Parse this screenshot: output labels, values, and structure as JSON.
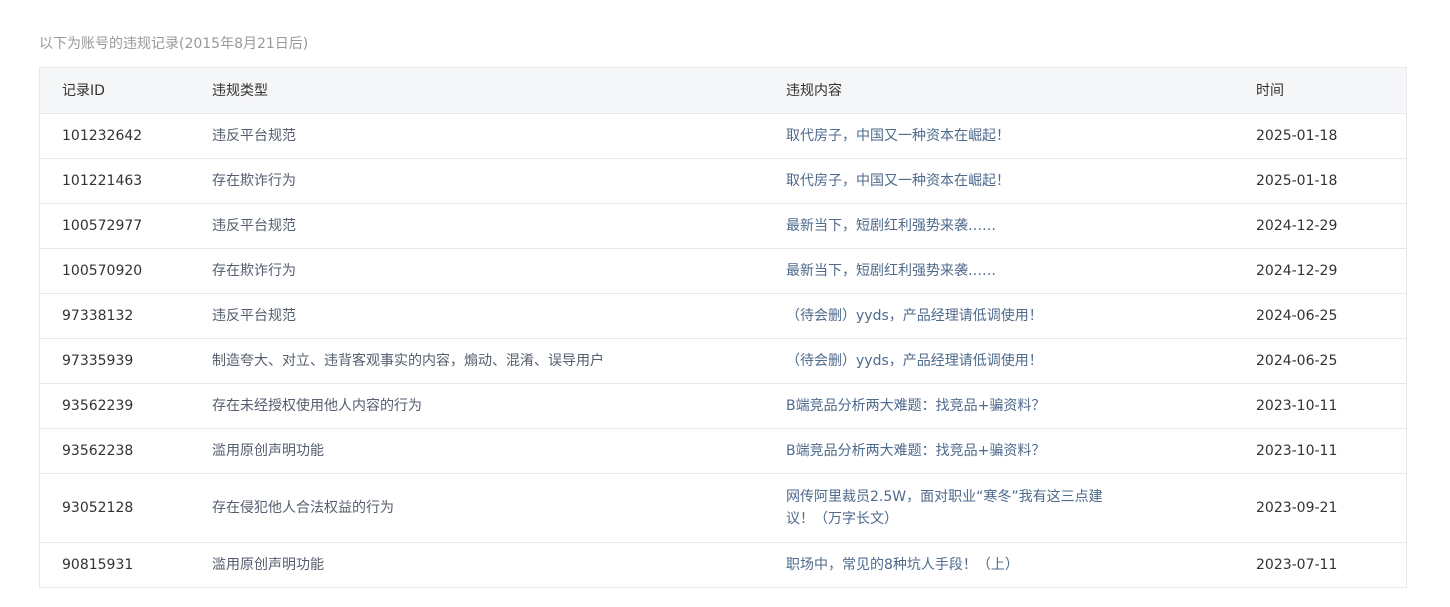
{
  "caption": "以下为账号的违规记录(2015年8月21日后)",
  "table": {
    "headers": [
      "记录ID",
      "违规类型",
      "违规内容",
      "时间"
    ],
    "rows": [
      {
        "id": "101232642",
        "type": "违反平台规范",
        "content": "取代房子，中国又一种资本在崛起！",
        "time": "2025-01-18"
      },
      {
        "id": "101221463",
        "type": "存在欺诈行为",
        "content": "取代房子，中国又一种资本在崛起！",
        "time": "2025-01-18"
      },
      {
        "id": "100572977",
        "type": "违反平台规范",
        "content": "最新当下，短剧红利强势来袭……",
        "time": "2024-12-29"
      },
      {
        "id": "100570920",
        "type": "存在欺诈行为",
        "content": "最新当下，短剧红利强势来袭……",
        "time": "2024-12-29"
      },
      {
        "id": "97338132",
        "type": "违反平台规范",
        "content": "（待会删）yyds，产品经理请低调使用！",
        "time": "2024-06-25"
      },
      {
        "id": "97335939",
        "type": "制造夸大、对立、违背客观事实的内容，煽动、混淆、误导用户",
        "content": "（待会删）yyds，产品经理请低调使用！",
        "time": "2024-06-25"
      },
      {
        "id": "93562239",
        "type": "存在未经授权使用他人内容的行为",
        "content": "B端竞品分析两大难题：找竞品+骗资料？",
        "time": "2023-10-11"
      },
      {
        "id": "93562238",
        "type": "滥用原创声明功能",
        "content": "B端竞品分析两大难题：找竞品+骗资料？",
        "time": "2023-10-11"
      },
      {
        "id": "93052128",
        "type": "存在侵犯他人合法权益的行为",
        "content": "网传阿里裁员2.5W，面对职业“寒冬”我有这三点建议！（万字长文）",
        "time": "2023-09-21"
      },
      {
        "id": "90815931",
        "type": "滥用原创声明功能",
        "content": "职场中，常见的8种坑人手段！（上）",
        "time": "2023-07-11"
      }
    ]
  }
}
